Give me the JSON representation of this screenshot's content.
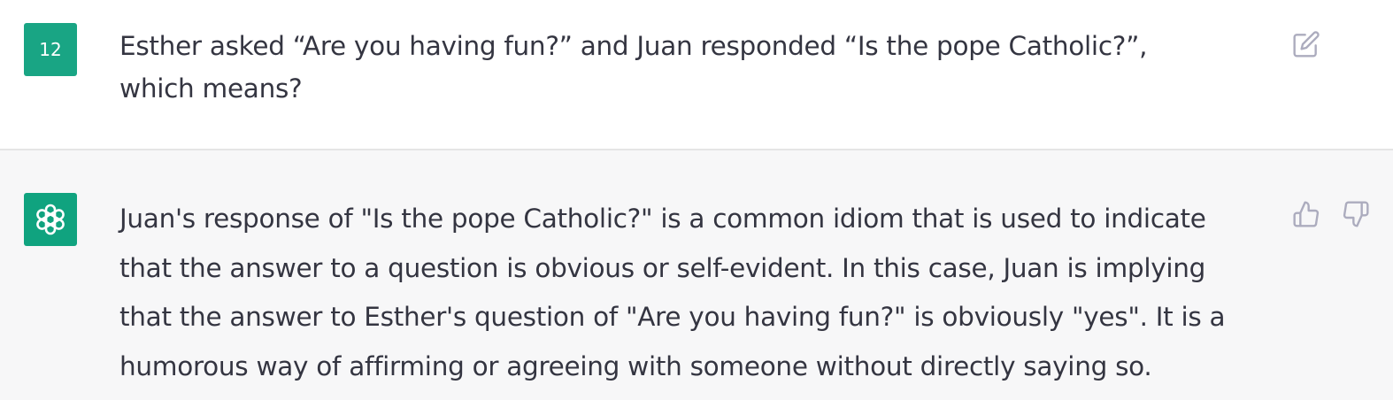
{
  "conversation": {
    "user_message": {
      "avatar_text": "12",
      "text": "Esther asked “Are you having fun?” and Juan responded “Is the pope Catholic?”, which means?",
      "icon": "edit-icon"
    },
    "assistant_message": {
      "avatar_icon": "openai-logo-icon",
      "text": "Juan's response of \"Is the pope Catholic?\" is a common idiom that is used to indicate that the answer to a question is obvious or self-evident. In this case, Juan is implying that the answer to Esther's question of \"Are you having fun?\" is obviously \"yes\". It is a humorous way of affirming or agreeing with someone without directly saying so.",
      "icons": [
        "thumbs-up-icon",
        "thumbs-down-icon"
      ]
    }
  },
  "colors": {
    "user_avatar": "#19a584",
    "assistant_avatar": "#10a37f",
    "assistant_background": "#f7f7f8",
    "text": "#343541",
    "icon": "#acacbe"
  }
}
